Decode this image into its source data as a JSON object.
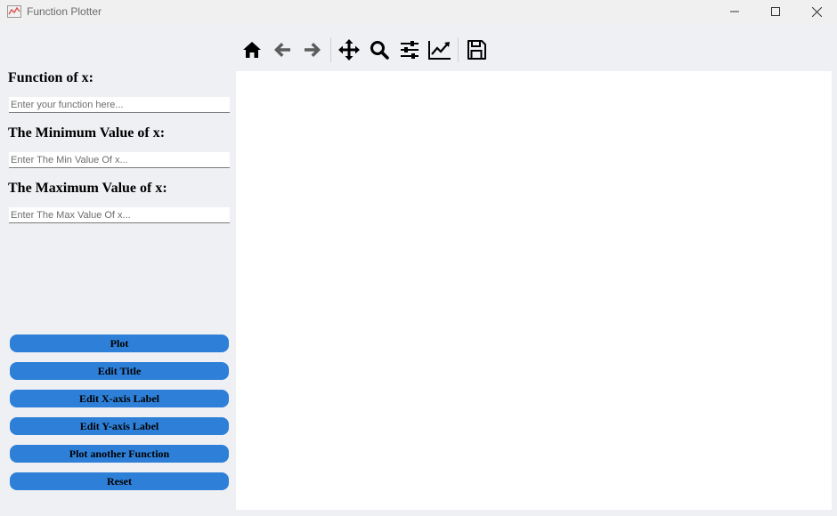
{
  "window": {
    "title": "Function Plotter",
    "accent_color": "#2e7fd7"
  },
  "toolbar": {
    "items": [
      {
        "icon": "home-icon"
      },
      {
        "icon": "back-arrow-icon"
      },
      {
        "icon": "forward-arrow-icon"
      },
      {
        "icon": "pan-icon"
      },
      {
        "icon": "zoom-icon"
      },
      {
        "icon": "configure-subplots-icon"
      },
      {
        "icon": "edit-axes-icon"
      },
      {
        "icon": "save-icon"
      }
    ]
  },
  "form": {
    "function_label": "Function of x:",
    "function_placeholder": "Enter your function here...",
    "function_value": "",
    "min_label": "The Minimum Value of x:",
    "min_placeholder": "Enter The Min Value Of x...",
    "min_value": "",
    "max_label": "The Maximum Value of x:",
    "max_placeholder": "Enter The Max Value Of x...",
    "max_value": ""
  },
  "buttons": {
    "plot": "Plot",
    "edit_title": "Edit Title",
    "edit_xlabel": "Edit X-axis Label",
    "edit_ylabel": "Edit Y-axis Label",
    "plot_another": "Plot another Function",
    "reset": "Reset"
  }
}
